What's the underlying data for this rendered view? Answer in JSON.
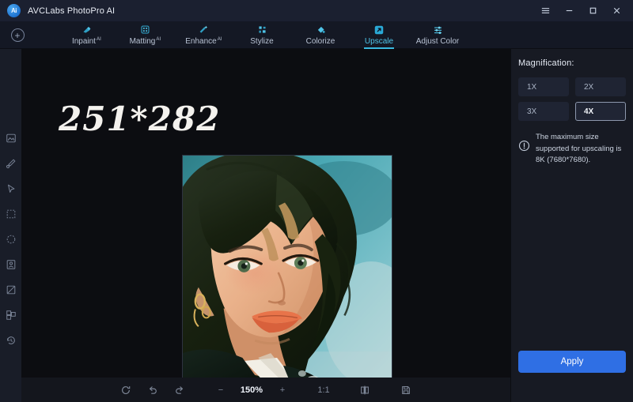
{
  "window": {
    "title": "AVCLabs PhotoPro AI",
    "logo_text": "Ai",
    "controls": {
      "menu": "menu-icon",
      "minimize": "minimize",
      "maximize": "maximize",
      "close": "close"
    }
  },
  "nav": {
    "add_button": "+",
    "tabs": [
      {
        "label": "Inpaint",
        "sup": "AI",
        "icon": "eraser-icon",
        "active": false
      },
      {
        "label": "Matting",
        "sup": "AI",
        "icon": "matting-icon",
        "active": false
      },
      {
        "label": "Enhance",
        "sup": "AI",
        "icon": "magic-wand-icon",
        "active": false
      },
      {
        "label": "Stylize",
        "sup": "",
        "icon": "stylize-icon",
        "active": false
      },
      {
        "label": "Colorize",
        "sup": "",
        "icon": "paint-bucket-icon",
        "active": false
      },
      {
        "label": "Upscale",
        "sup": "",
        "icon": "upscale-icon",
        "active": true
      },
      {
        "label": "Adjust Color",
        "sup": "",
        "icon": "sliders-icon",
        "active": false
      }
    ]
  },
  "left_toolbar": {
    "tools": [
      {
        "name": "image-tool-icon"
      },
      {
        "name": "brush-tool-icon"
      },
      {
        "name": "cursor-tool-icon"
      },
      {
        "name": "rectangle-select-icon"
      },
      {
        "name": "ellipse-select-icon"
      },
      {
        "name": "portrait-tool-icon"
      },
      {
        "name": "crop-tool-icon"
      },
      {
        "name": "layers-tool-icon"
      },
      {
        "name": "history-tool-icon"
      }
    ]
  },
  "canvas": {
    "dimension_label": "251*282",
    "image_alt": "portrait-illustration"
  },
  "bottom_toolbar": {
    "reset_label": "reset-icon",
    "undo_label": "undo-icon",
    "redo_label": "redo-icon",
    "zoom_out_label": "−",
    "zoom_value": "150%",
    "zoom_in_label": "+",
    "fit_label": "1:1",
    "compare_label": "compare-icon",
    "save_label": "save-icon"
  },
  "right_panel": {
    "title": "Magnification:",
    "options": [
      {
        "label": "1X",
        "selected": false
      },
      {
        "label": "2X",
        "selected": false
      },
      {
        "label": "3X",
        "selected": false
      },
      {
        "label": "4X",
        "selected": true
      }
    ],
    "info_text": "The maximum size supported for upscaling is 8K (7680*7680).",
    "apply_label": "Apply"
  },
  "colors": {
    "accent_cyan": "#39b9e0",
    "apply_blue": "#2f6fe4",
    "titlebar_bg": "#1b2030",
    "panel_bg": "#171a23",
    "canvas_bg": "#0c0d11"
  }
}
